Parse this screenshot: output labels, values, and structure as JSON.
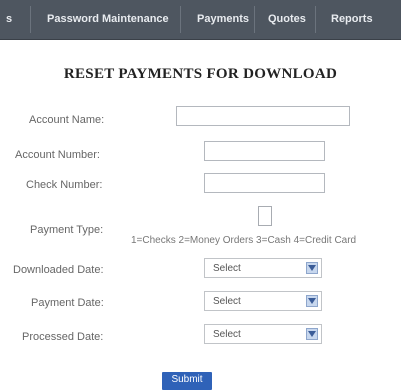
{
  "nav": {
    "items": [
      {
        "label": "s"
      },
      {
        "label": "Password Maintenance"
      },
      {
        "label": "Payments"
      },
      {
        "label": "Quotes"
      },
      {
        "label": "Reports"
      }
    ]
  },
  "form": {
    "title": "RESET PAYMENTS FOR DOWNLOAD",
    "account_name_label": "Account Name:",
    "account_name_value": "",
    "account_number_label": "Account Number:",
    "account_number_value": "",
    "check_number_label": "Check Number:",
    "check_number_value": "",
    "payment_type_label": "Payment Type:",
    "payment_type_hint": "1=Checks 2=Money Orders 3=Cash 4=Credit Card",
    "downloaded_date_label": "Downloaded Date:",
    "downloaded_date_value": "Select",
    "payment_date_label": "Payment Date:",
    "payment_date_value": "Select",
    "processed_date_label": "Processed Date:",
    "processed_date_value": "Select",
    "submit_label": "Submit"
  },
  "colors": {
    "navbar": "#4e5660",
    "submit": "#2f62b8",
    "select_arrow": "#c7d7ee"
  }
}
